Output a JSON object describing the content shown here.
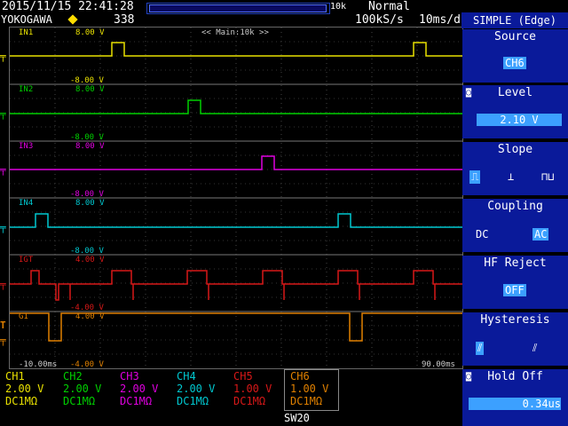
{
  "header": {
    "datetime": "2015/11/15 22:41:28",
    "brand": "YOKOGAWA",
    "count": "338",
    "zoom_factor": "10k",
    "mode": "Normal",
    "sample_rate": "100kS/s",
    "timebase": "10ms/div"
  },
  "screen": {
    "zoom_label": "<< Main:10k >>",
    "time_start": "-10.00ms",
    "time_end": "90.00ms",
    "channels": [
      {
        "name": "IN1",
        "top": "8.00 V",
        "bottom": "-8.00 V",
        "color": "#e8e000"
      },
      {
        "name": "IN2",
        "top": "8.00 V",
        "bottom": "-8.00 V",
        "color": "#00d000"
      },
      {
        "name": "IN3",
        "top": "8.00 V",
        "bottom": "-8.00 V",
        "color": "#e000e0"
      },
      {
        "name": "IN4",
        "top": "8.00 V",
        "bottom": "-8.00 V",
        "color": "#00c8d0"
      },
      {
        "name": "IGT",
        "top": "4.00 V",
        "bottom": "-4.00 V",
        "color": "#d81818"
      },
      {
        "name": "G1",
        "top": "4.00 V",
        "bottom": "-4.00 V",
        "color": "#e08000"
      }
    ]
  },
  "panel": {
    "title": "SIMPLE (Edge)",
    "source": {
      "label": "Source",
      "value": "CH6"
    },
    "level": {
      "label": "Level",
      "value": "2.10 V"
    },
    "slope": {
      "label": "Slope",
      "options": [
        "rise",
        "fall",
        "both"
      ],
      "selected": "rise"
    },
    "coupling": {
      "label": "Coupling",
      "options": [
        "DC",
        "AC"
      ],
      "selected": "AC"
    },
    "hf_reject": {
      "label": "HF Reject",
      "value": "OFF"
    },
    "hysteresis": {
      "label": "Hysteresis",
      "options": [
        "low",
        "high"
      ],
      "selected": "low"
    },
    "hold_off": {
      "label": "Hold Off",
      "value": "0.34us"
    }
  },
  "bottom": {
    "channels": [
      {
        "name": "CH1",
        "volts": "2.00 V",
        "coupling": "DC1MΩ",
        "color": "#e8e000"
      },
      {
        "name": "CH2",
        "volts": "2.00 V",
        "coupling": "DC1MΩ",
        "color": "#00d000"
      },
      {
        "name": "CH3",
        "volts": "2.00 V",
        "coupling": "DC1MΩ",
        "color": "#e000e0"
      },
      {
        "name": "CH4",
        "volts": "2.00 V",
        "coupling": "DC1MΩ",
        "color": "#00c8d0"
      },
      {
        "name": "CH5",
        "volts": "1.00 V",
        "coupling": "DC1MΩ",
        "color": "#d81818"
      },
      {
        "name": "CH6",
        "volts": "1.00 V",
        "coupling": "DC1MΩ",
        "color": "#e08000"
      }
    ],
    "switch_label": "SW20"
  }
}
